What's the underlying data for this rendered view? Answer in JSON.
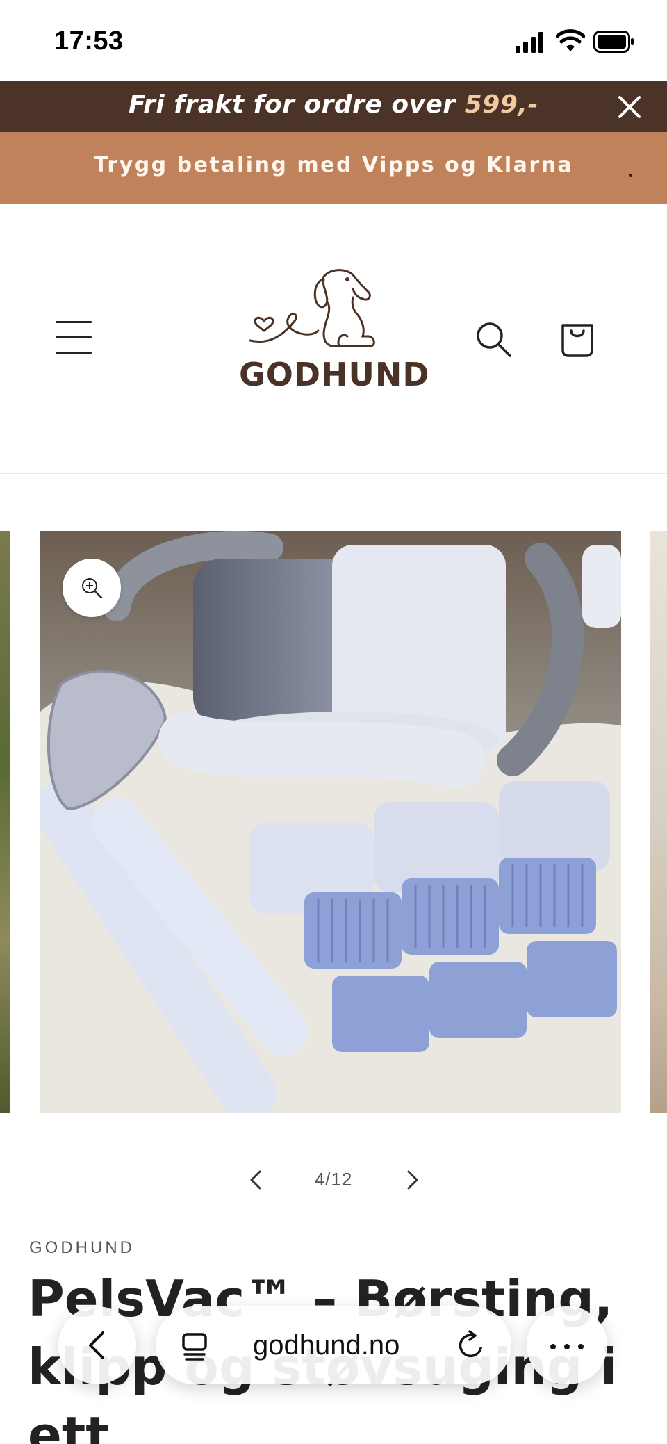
{
  "status_bar": {
    "time": "17:53"
  },
  "announcement": {
    "text_main": "Fri frakt for ordre over ",
    "text_highlight": "599,-",
    "subtext": "Trygg betaling med Vipps og Klarna",
    "highlight_color": "#f5c8a0",
    "bar_color": "#4b3427",
    "sub_bar_color": "#c0825a"
  },
  "header": {
    "logo_text": "GODHUND"
  },
  "gallery": {
    "pagination": "4/12"
  },
  "product": {
    "vendor": "GODHUND",
    "title_lines": [
      "PelsVac™ – Børsting,",
      "klipp og støvsuging i",
      "ett"
    ]
  },
  "browser": {
    "url": "godhund.no"
  },
  "icons": {
    "close": "close-icon",
    "menu": "hamburger-menu-icon",
    "search": "search-icon",
    "cart": "cart-icon",
    "zoom": "zoom-in-icon",
    "prev": "chevron-left-icon",
    "next": "chevron-right-icon",
    "back": "back-arrow-icon",
    "tabs": "tabs-icon",
    "reload": "reload-icon",
    "more": "more-icon"
  }
}
